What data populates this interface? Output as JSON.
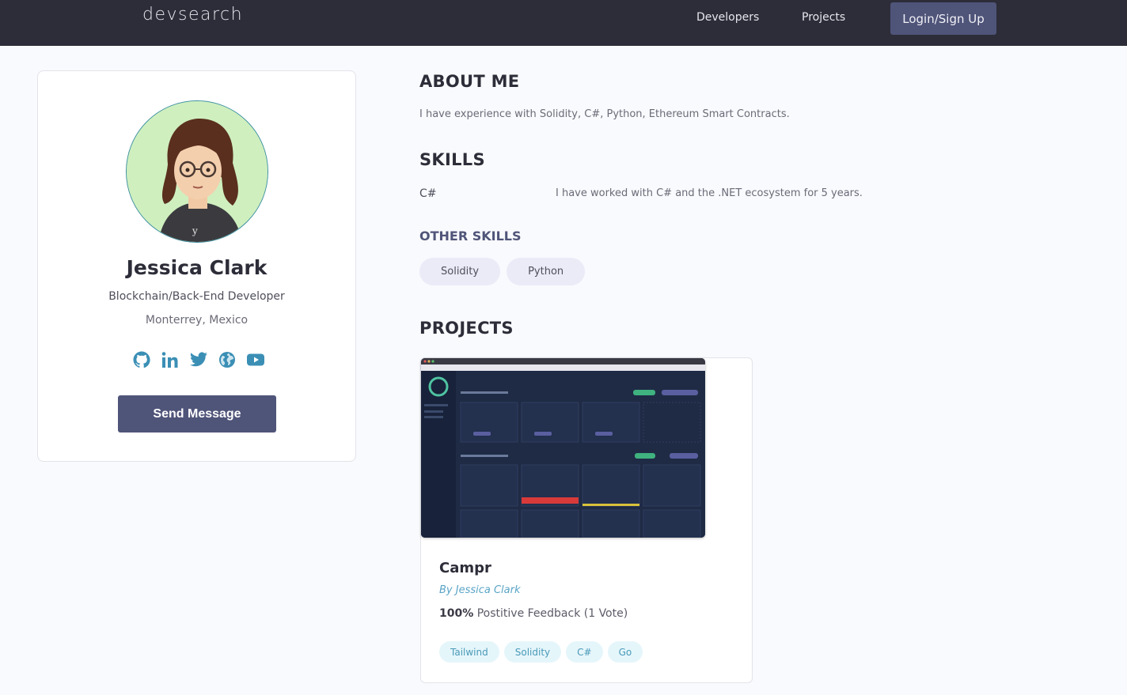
{
  "nav": {
    "logo": "devsearch",
    "links": [
      "Developers",
      "Projects"
    ],
    "login": "Login/Sign Up"
  },
  "profile": {
    "name": "Jessica Clark",
    "title": "Blockchain/Back-End Developer",
    "location": "Monterrey, Mexico",
    "socials": [
      "github-icon",
      "linkedin-icon",
      "twitter-icon",
      "globe-icon",
      "youtube-icon"
    ],
    "send_message": "Send Message",
    "accent_color": "#4f5479",
    "social_icon_color": "#3b8fb5"
  },
  "about": {
    "heading": "ABOUT ME",
    "text": "I have experience with Solidity, C#, Python, Ethereum Smart Contracts."
  },
  "skills": {
    "heading": "SKILLS",
    "items": [
      {
        "name": "C#",
        "description": "I have worked with C# and the .NET ecosystem for 5 years."
      }
    ],
    "other_heading": "OTHER SKILLS",
    "other": [
      "Solidity",
      "Python"
    ]
  },
  "projects": {
    "heading": "PROJECTS",
    "items": [
      {
        "title": "Campr",
        "author": "By Jessica Clark",
        "feedback_percent": "100%",
        "feedback_text": "Postitive Feedback (1 Vote)",
        "tags": [
          "Tailwind",
          "Solidity",
          "C#",
          "Go"
        ]
      }
    ]
  }
}
